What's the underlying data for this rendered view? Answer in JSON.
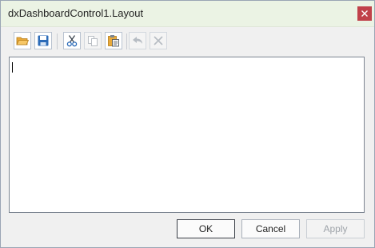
{
  "window": {
    "title": "dxDashboardControl1.Layout"
  },
  "toolbar": {
    "items": [
      {
        "icon": "open-folder-icon",
        "enabled": true
      },
      {
        "icon": "save-icon",
        "enabled": true
      },
      {
        "icon": "cut-icon",
        "enabled": true
      },
      {
        "icon": "copy-icon",
        "enabled": false
      },
      {
        "icon": "paste-icon",
        "enabled": true
      },
      {
        "icon": "undo-icon",
        "enabled": false
      },
      {
        "icon": "delete-icon",
        "enabled": false
      }
    ]
  },
  "editor": {
    "value": ""
  },
  "buttons": {
    "ok": "OK",
    "cancel": "Cancel",
    "apply": "Apply"
  },
  "colors": {
    "titlebar": "#ebf3e4",
    "close": "#c0414a",
    "accent": "#2b6bb8"
  }
}
